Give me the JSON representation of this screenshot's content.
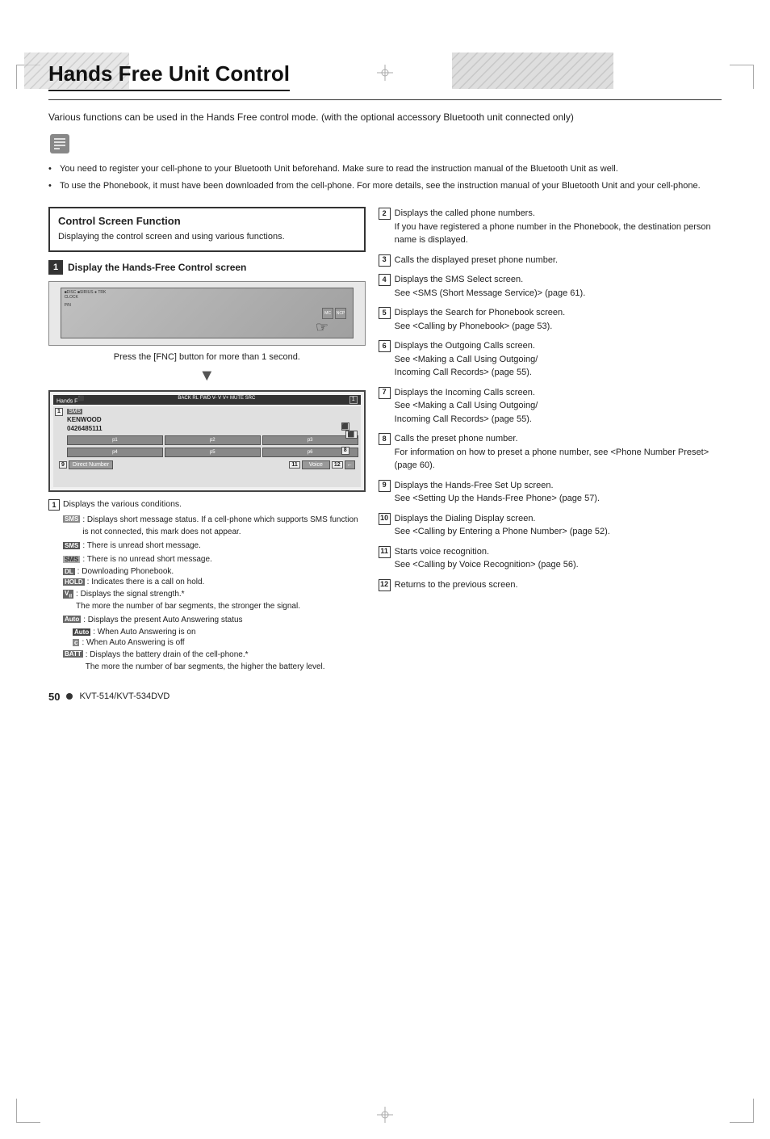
{
  "page": {
    "title": "Hands Free Unit Control",
    "intro": "Various functions can be used in the Hands Free control mode. (with the optional accessory Bluetooth unit connected only)",
    "bullets": [
      "You need to register your cell-phone to your Bluetooth Unit beforehand. Make sure to read the instruction manual of the Bluetooth Unit as well.",
      "To use the Phonebook, it must have been downloaded from the cell-phone. For more details, see the instruction manual of your Bluetooth Unit and your cell-phone."
    ]
  },
  "csf": {
    "title": "Control Screen Function",
    "desc": "Displaying the control screen and using various functions."
  },
  "step1": {
    "num": "1",
    "label": "Display the Hands-Free Control screen"
  },
  "screen_mockup": {
    "press_text": "Press the [FNC] button for more than 1 second."
  },
  "hf_screen": {
    "title": "Hands Free",
    "status_bar": "BACK  RL  FWD  V-  V  V+  MUTE  SRC",
    "name": "KENWOOD",
    "number": "0426485111",
    "btn_labels": [
      "p1",
      "p2",
      "p3",
      "p4",
      "p5",
      "p6"
    ],
    "bottom_labels": [
      "Direct Number",
      "Voice"
    ]
  },
  "conditions": [
    {
      "num": "1",
      "text": "Displays the various conditions.",
      "sub": [
        {
          "badge": "SMS",
          "text": ": Displays short message status. If a cell-phone which supports SMS function is not connected, this mark does not appear."
        },
        {
          "badge": "SMS",
          "badge2": true,
          "text": ": There is unread short message."
        },
        {
          "badge": "SMS",
          "badge3": true,
          "text": ": There is no unread short message."
        },
        {
          "badge": "DL",
          "text": ": Downloading Phonebook."
        },
        {
          "badge": "HOLD",
          "text": ": Indicates there is a call on hold."
        },
        {
          "badge": "Vil",
          "text": ": Displays the signal strength.*\nThe more the number of bar segments, the stronger the signal."
        },
        {
          "badge": "Auto",
          "text": ": Displays the present Auto Answering status"
        },
        {
          "badge": "Auto+",
          "text": ": When Auto Answering is on"
        },
        {
          "badge": "c",
          "text": ": When Auto Answering is off"
        },
        {
          "badge": "BATT",
          "text": ": Displays the battery drain of the cell-phone.*\nThe more the number of bar segments, the higher the battery level."
        }
      ]
    }
  ],
  "right_items": [
    {
      "num": "2",
      "text": "Displays the called phone numbers.\nIf you have registered a phone number in the Phonebook, the destination person name is displayed."
    },
    {
      "num": "3",
      "text": "Calls the displayed preset phone number."
    },
    {
      "num": "4",
      "text": "Displays the SMS Select screen.\nSee <SMS (Short Message Service)> (page 61)."
    },
    {
      "num": "5",
      "text": "Displays the Search for Phonebook screen.\nSee <Calling by Phonebook> (page 53)."
    },
    {
      "num": "6",
      "text": "Displays the Outgoing Calls screen.\nSee <Making a Call Using Outgoing/Incoming Call Records> (page 55)."
    },
    {
      "num": "7",
      "text": "Displays the Incoming Calls screen.\nSee <Making a Call Using Outgoing/Incoming Call Records> (page 55)."
    },
    {
      "num": "8",
      "text": "Calls the preset phone number.\nFor information on how to preset a phone number, see <Phone Number Preset> (page 60)."
    },
    {
      "num": "9",
      "text": "Displays the Hands-Free Set Up screen.\nSee <Setting Up the Hands-Free Phone> (page 57)."
    },
    {
      "num": "10",
      "text": "Displays the Dialing Display screen.\nSee <Calling by Entering a Phone Number> (page 52)."
    },
    {
      "num": "11",
      "text": "Starts voice recognition.\nSee <Calling by Voice Recognition> (page 56)."
    },
    {
      "num": "12",
      "text": "Returns to the previous screen."
    }
  ],
  "footer": {
    "page_num": "50",
    "model": "KVT-514/KVT-534DVD"
  }
}
